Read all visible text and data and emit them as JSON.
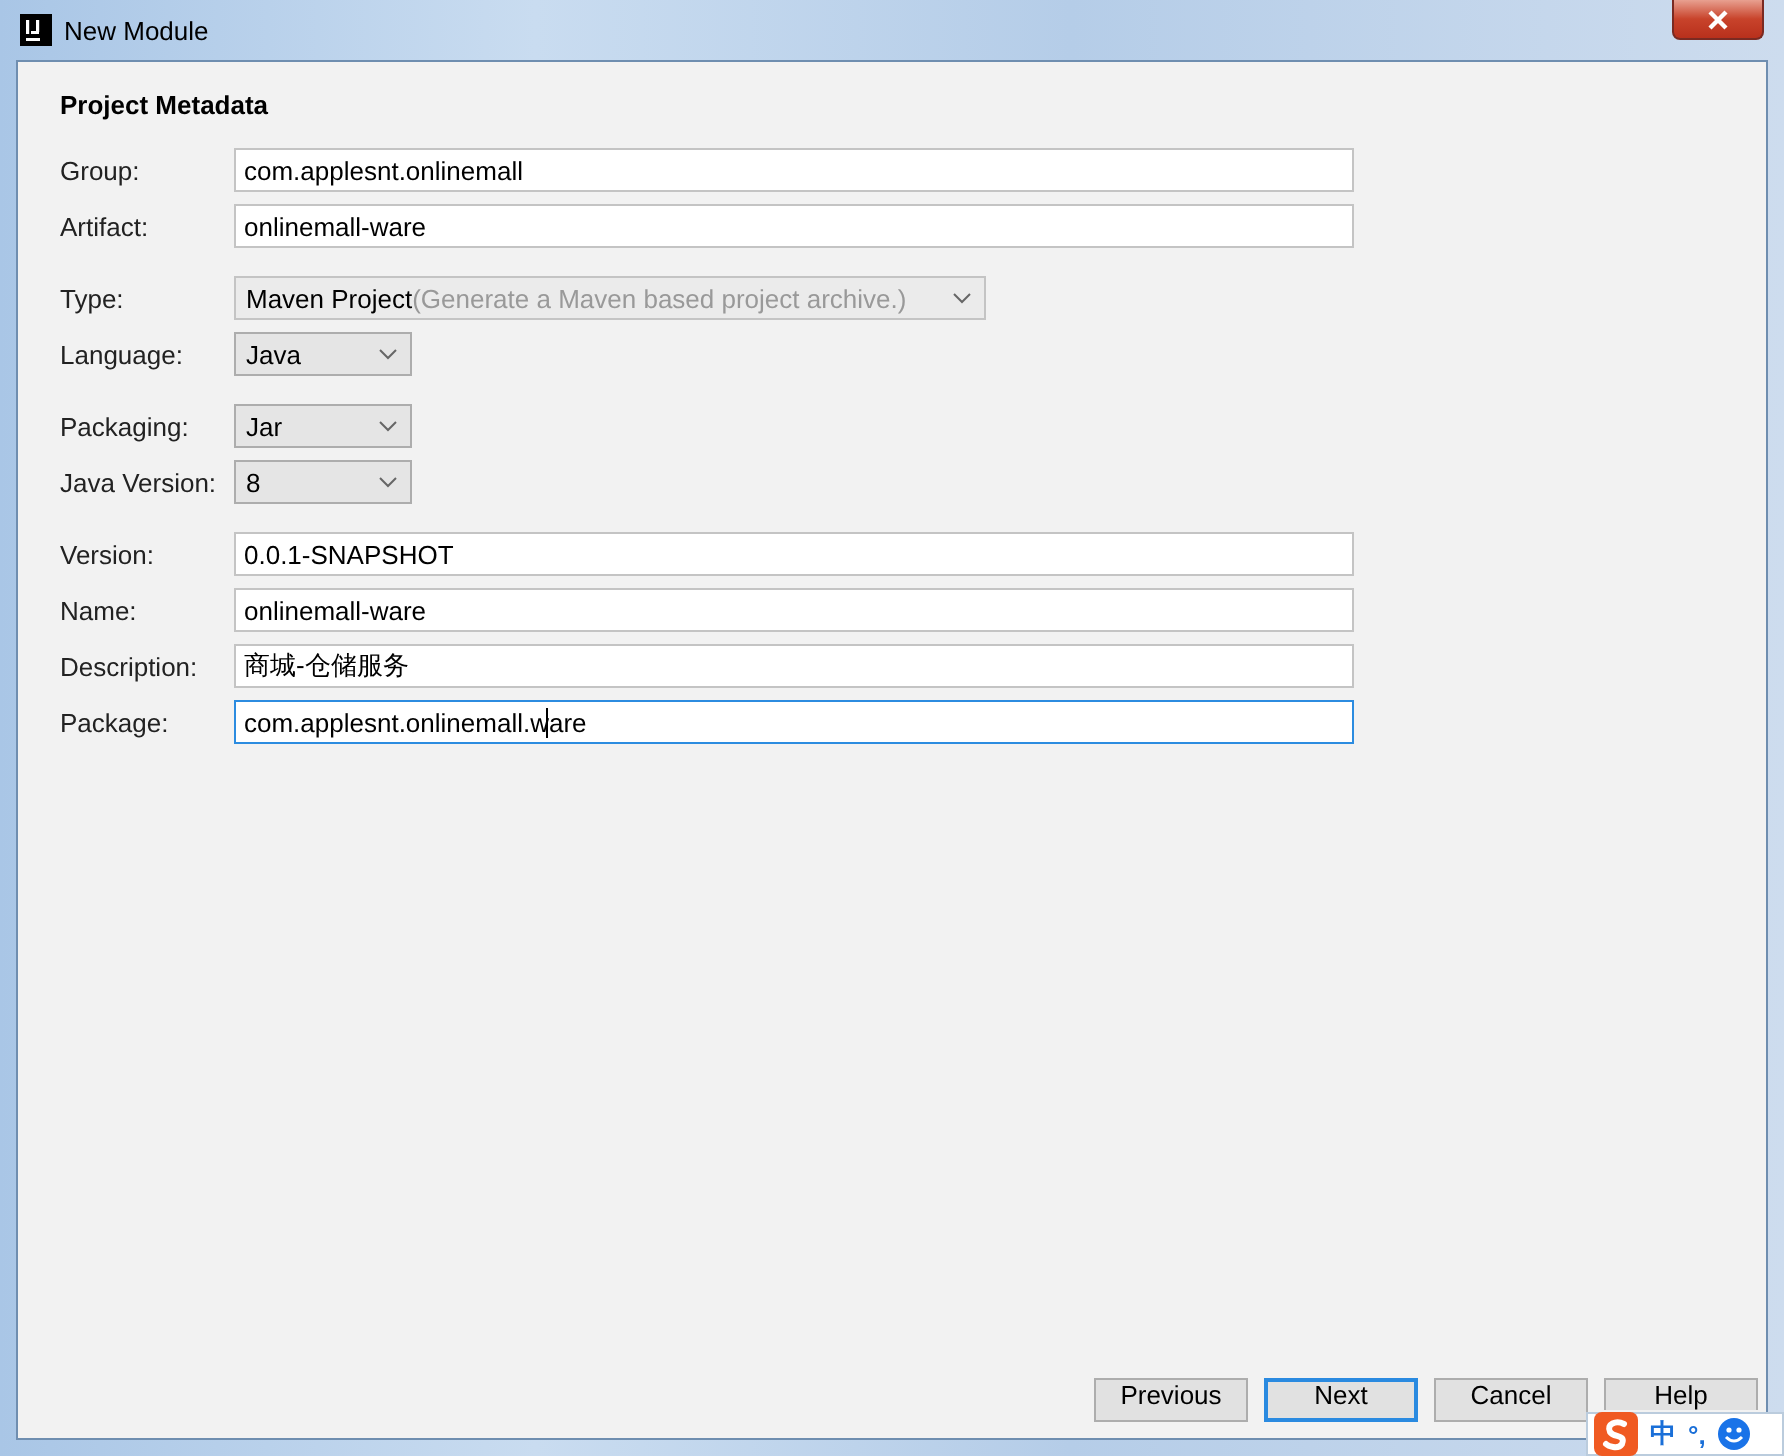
{
  "window": {
    "title": "New Module"
  },
  "section_title": "Project Metadata",
  "groups": [
    [
      {
        "label": "Group:",
        "kind": "text",
        "value": "com.applesnt.onlinemall",
        "focused": false
      },
      {
        "label": "Artifact:",
        "kind": "text",
        "value": "onlinemall-ware",
        "focused": false
      }
    ],
    [
      {
        "label": "Type:",
        "kind": "wide-combo",
        "value": "Maven Project",
        "hint": "(Generate a Maven based project archive.)",
        "disabled": true
      },
      {
        "label": "Language:",
        "kind": "combo",
        "value": "Java",
        "disabled": false
      }
    ],
    [
      {
        "label": "Packaging:",
        "kind": "combo",
        "value": "Jar",
        "disabled": false
      },
      {
        "label": "Java Version:",
        "kind": "combo",
        "value": "8",
        "disabled": false
      }
    ],
    [
      {
        "label": "Version:",
        "kind": "text",
        "value": "0.0.1-SNAPSHOT",
        "focused": false
      },
      {
        "label": "Name:",
        "kind": "text",
        "value": "onlinemall-ware",
        "focused": false
      },
      {
        "label": "Description:",
        "kind": "text",
        "value": "商城-仓储服务",
        "focused": false
      },
      {
        "label": "Package:",
        "kind": "text",
        "value": "com.applesnt.onlinemall.ware",
        "focused": true
      }
    ]
  ],
  "buttons": [
    {
      "label": "Previous",
      "default": false
    },
    {
      "label": "Next",
      "default": true
    },
    {
      "label": "Cancel",
      "default": false
    },
    {
      "label": "Help",
      "default": false
    }
  ],
  "ime_toolbar": {
    "mode": "中",
    "punctuation": "°,"
  }
}
